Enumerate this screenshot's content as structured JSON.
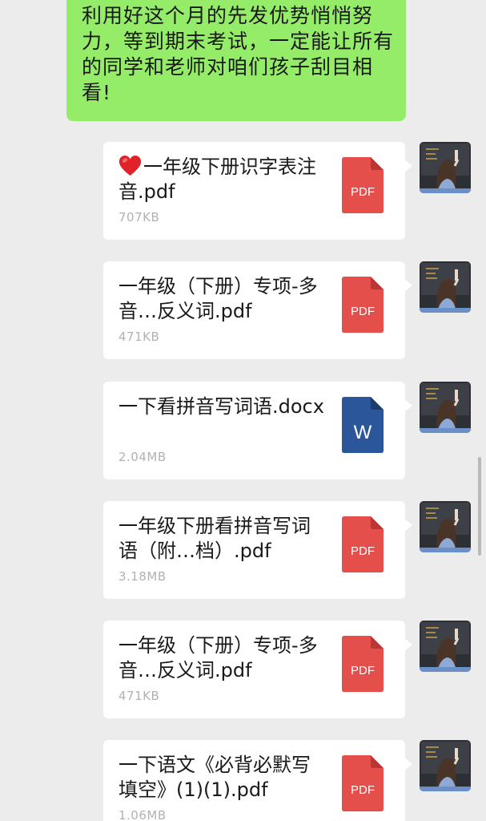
{
  "conversation": {
    "text_message": "利用好这个月的先发优势悄悄努力，等到期末考试，一定能让所有的同学和老师对咱们孩子刮目相看!",
    "files": [
      {
        "name": "一年级下册识字表注音.pdf",
        "size": "707KB",
        "type": "PDF",
        "icon": "pdf-icon",
        "has_heart": true,
        "heart_icon": "red-heart-emoji"
      },
      {
        "name": "一年级（下册）专项-多音…反义词.pdf",
        "size": "471KB",
        "type": "PDF",
        "icon": "pdf-icon",
        "has_heart": false
      },
      {
        "name": "一下看拼音写词语.docx",
        "size": "2.04MB",
        "type": "W",
        "icon": "word-icon",
        "has_heart": false
      },
      {
        "name": "一年级下册看拼音写词语（附…档）.pdf",
        "size": "3.18MB",
        "type": "PDF",
        "icon": "pdf-icon",
        "has_heart": false
      },
      {
        "name": "一年级（下册）专项-多音…反义词.pdf",
        "size": "471KB",
        "type": "PDF",
        "icon": "pdf-icon",
        "has_heart": false
      },
      {
        "name": "一下语文《必背必默写填空》(1)(1).pdf",
        "size": "1.06MB",
        "type": "PDF",
        "icon": "pdf-icon",
        "has_heart": false
      }
    ],
    "sender_avatar": "teacher-at-blackboard-avatar"
  },
  "colors": {
    "background": "#ececec",
    "bubble_green": "#95ec69",
    "pdf_red": "#e44e4b",
    "word_blue": "#2b579a",
    "file_size_gray": "#b2b2b2"
  }
}
